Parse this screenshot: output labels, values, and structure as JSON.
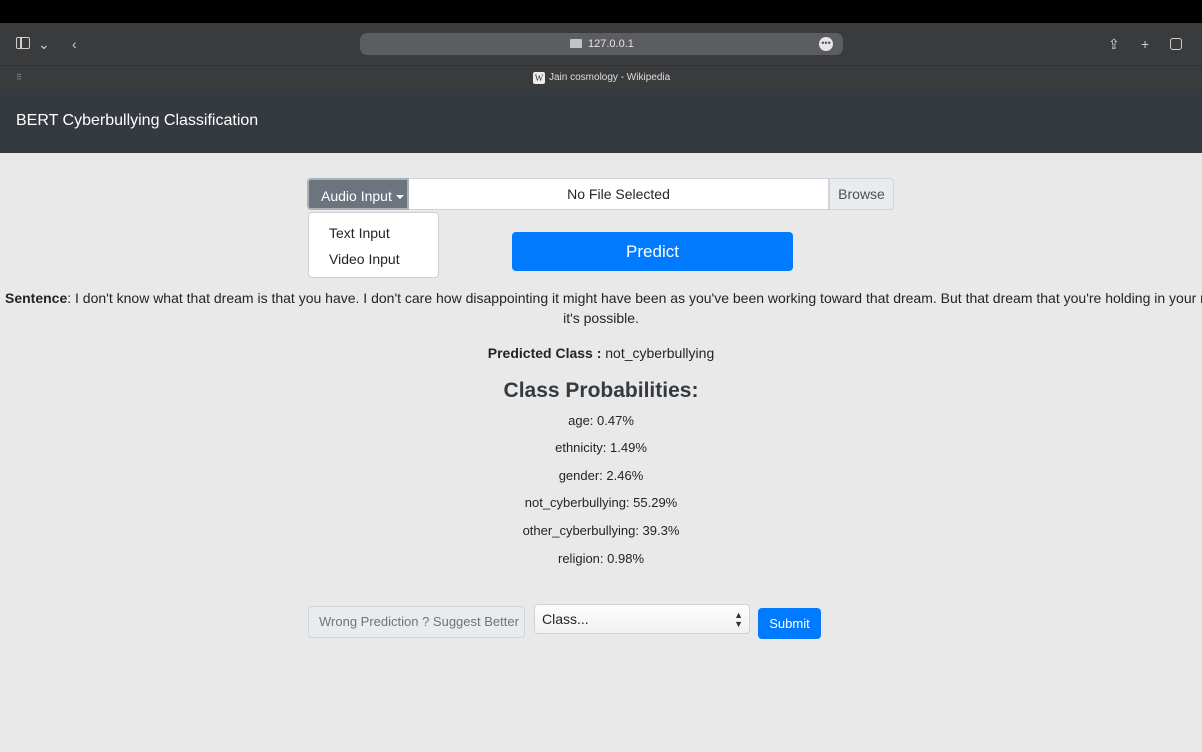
{
  "browser": {
    "url": "127.0.0.1",
    "tab_title": "Jain cosmology - Wikipedia",
    "more_glyph": "•••"
  },
  "navbar": {
    "brand": "BERT Cyberbullying Classification"
  },
  "input": {
    "mode_label": "Audio Input",
    "file_status": "No File Selected",
    "browse_label": "Browse",
    "menu_items": [
      "Text Input",
      "Video Input"
    ]
  },
  "predict_label": "Predict",
  "result": {
    "sentence_label": "Sentence",
    "sentence_line1": ": I don't know what that dream is that you have. I don't care how disappointing it might have been as you've been working toward that dream. But that dream that you're holding in your mind that",
    "sentence_line2": "it's possible.",
    "predicted_label": "Predicted Class :",
    "predicted_value": "not_cyberbullying",
    "probabilities_title": "Class Probabilities:",
    "probabilities": [
      "age: 0.47%",
      "ethnicity: 1.49%",
      "gender: 2.46%",
      "not_cyberbullying: 55.29%",
      "other_cyberbullying: 39.3%",
      "religion: 0.98%"
    ]
  },
  "feedback": {
    "suggest_text": "Wrong Prediction ? Suggest Better",
    "select_value": "Class...",
    "submit_label": "Submit"
  },
  "icons": [
    "sidebar-icon",
    "chevron-down-icon",
    "back-icon",
    "share-icon",
    "new-tab-icon",
    "tabs-overview-icon",
    "wikipedia-icon"
  ]
}
